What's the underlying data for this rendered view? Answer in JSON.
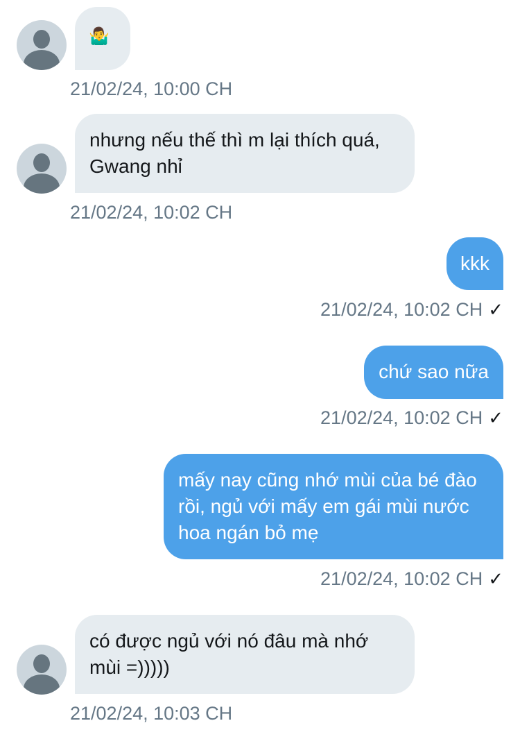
{
  "conversation": {
    "messages": [
      {
        "direction": "in",
        "text": "🤷‍♂️",
        "timestamp": "21/02/24, 10:00 CH"
      },
      {
        "direction": "in",
        "text": "nhưng nếu thế thì m lại thích quá, Gwang nhỉ",
        "timestamp": "21/02/24, 10:02 CH"
      },
      {
        "direction": "out",
        "text": "kkk",
        "timestamp": "21/02/24, 10:02 CH",
        "status": "✓"
      },
      {
        "direction": "out",
        "text": "chứ sao nữa",
        "timestamp": "21/02/24, 10:02 CH",
        "status": "✓"
      },
      {
        "direction": "out",
        "text": "mấy nay cũng nhớ mùi của bé đào rồi, ngủ với mấy em gái mùi nước hoa ngán bỏ mẹ",
        "timestamp": "21/02/24, 10:02 CH",
        "status": "✓"
      },
      {
        "direction": "in",
        "text": "có được ngủ với nó đâu mà nhớ mùi =)))))",
        "timestamp": "21/02/24, 10:03 CH"
      }
    ]
  },
  "colors": {
    "incoming_bubble": "#e6ecf0",
    "outgoing_bubble": "#4da1e9",
    "timestamp": "#657786",
    "avatar_bg": "#ccd6dd",
    "avatar_fg": "#66757f"
  },
  "icons": {
    "avatar": "default-profile-icon",
    "status": "checkmark-icon"
  }
}
